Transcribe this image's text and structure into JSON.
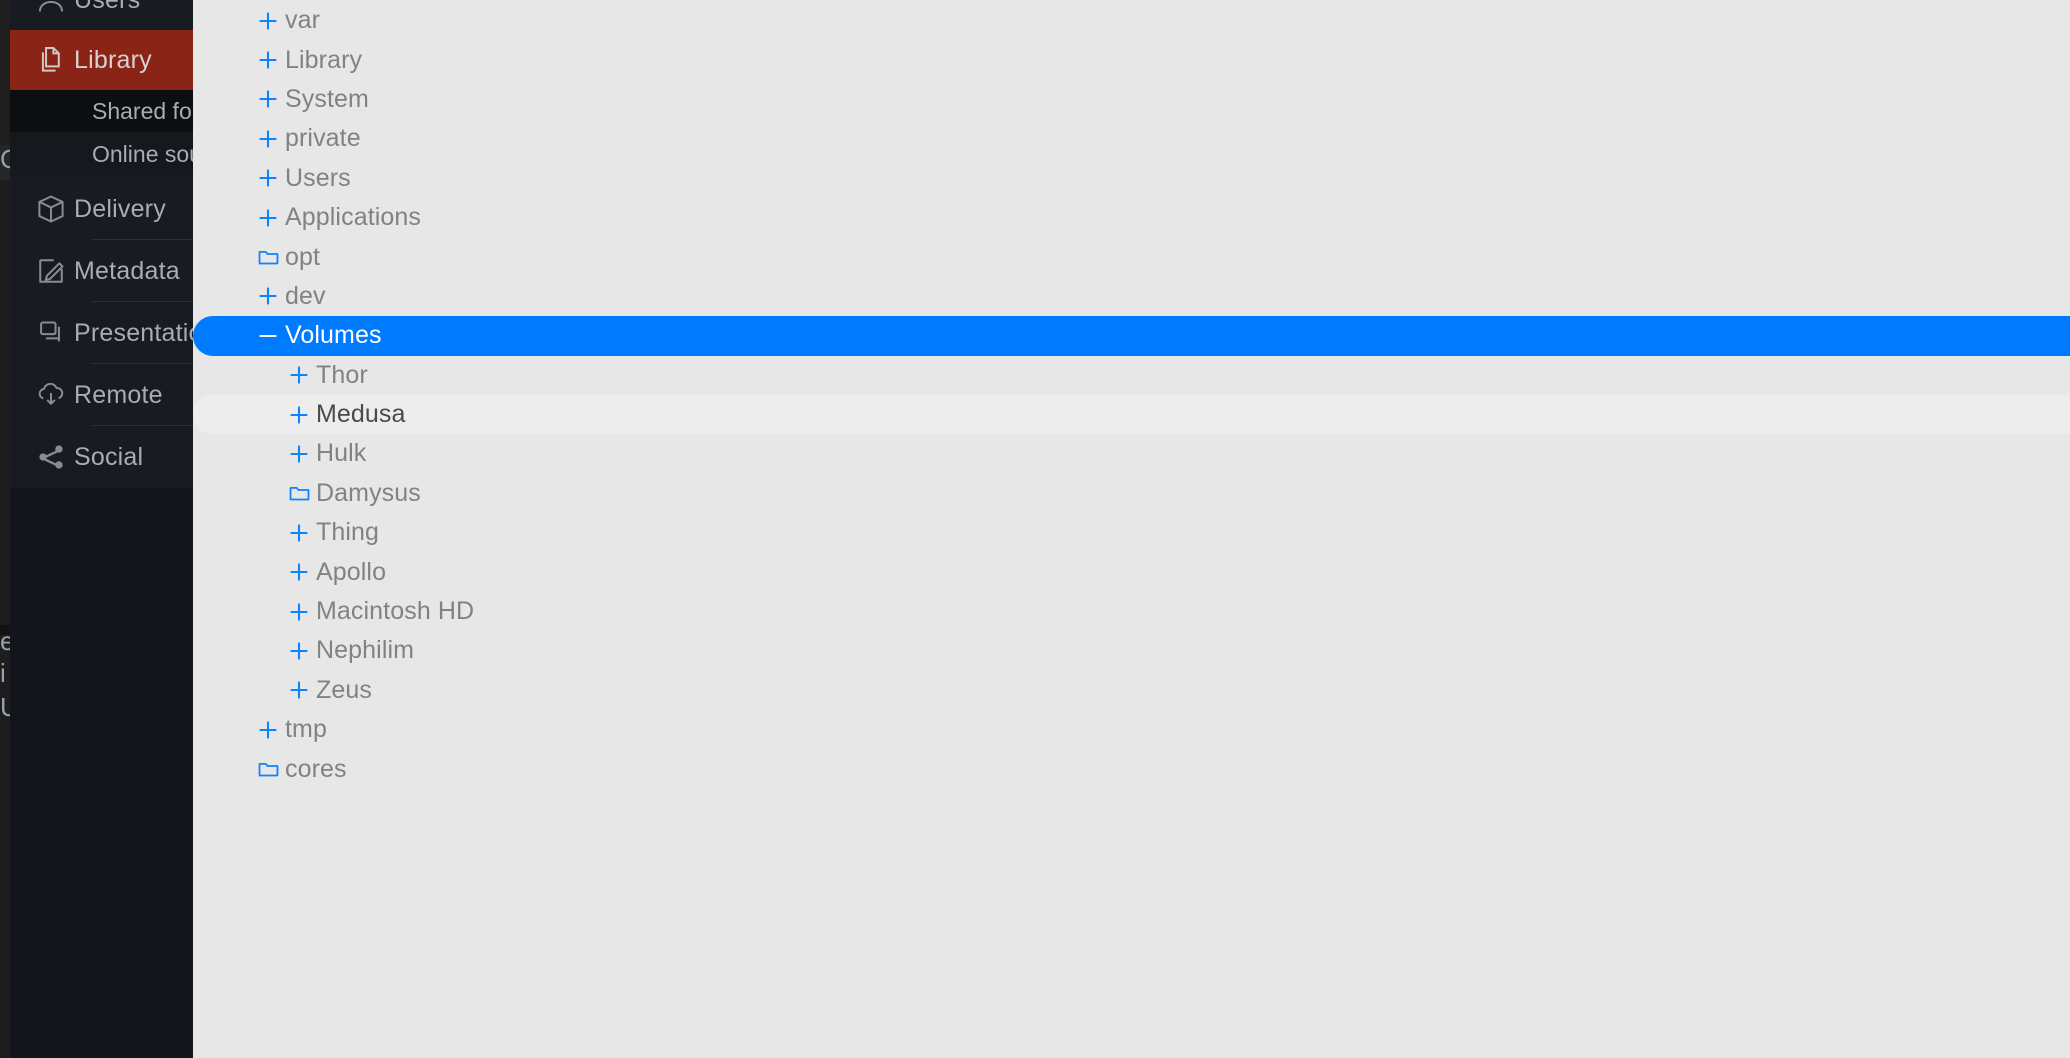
{
  "theme": {
    "sidebar_bg": "#181c20",
    "sidebar_active_bg": "#8a2417",
    "sidebar_sub_bg": "#0c0e10",
    "tree_bg": "#e7e7e7",
    "selection_blue": "#007aff",
    "expander_blue": "#0a84ff",
    "hover_bg": "#ededed",
    "tree_text": "#828282",
    "sidebar_text": "#a7adb3"
  },
  "sidebar": {
    "items": [
      {
        "label": "Users",
        "icon": "user-icon",
        "state": "normal",
        "type": "item"
      },
      {
        "label": "Library",
        "icon": "documents-icon",
        "state": "active",
        "type": "item"
      },
      {
        "label": "Shared folders",
        "icon": "",
        "state": "normal",
        "type": "sub"
      },
      {
        "label": "Online sources",
        "icon": "",
        "state": "normal",
        "type": "sub"
      },
      {
        "label": "Delivery",
        "icon": "box-icon",
        "state": "normal",
        "type": "item"
      },
      {
        "label": "Metadata",
        "icon": "pencil-edit-icon",
        "state": "normal",
        "type": "item"
      },
      {
        "label": "Presentation",
        "icon": "windows-icon",
        "state": "normal",
        "type": "item"
      },
      {
        "label": "Remote",
        "icon": "cloud-download-icon",
        "state": "normal",
        "type": "item"
      },
      {
        "label": "Social",
        "icon": "share-icon",
        "state": "normal",
        "type": "item"
      }
    ]
  },
  "edge_fragments": [
    {
      "text": "C"
    },
    {
      "text": "e"
    },
    {
      "text": "i"
    },
    {
      "text": "U"
    }
  ],
  "tree": {
    "nodes": [
      {
        "label": "var",
        "depth": 1,
        "expander": "plus",
        "state": "normal"
      },
      {
        "label": "Library",
        "depth": 1,
        "expander": "plus",
        "state": "normal"
      },
      {
        "label": "System",
        "depth": 1,
        "expander": "plus",
        "state": "normal"
      },
      {
        "label": "private",
        "depth": 1,
        "expander": "plus",
        "state": "normal"
      },
      {
        "label": "Users",
        "depth": 1,
        "expander": "plus",
        "state": "normal"
      },
      {
        "label": "Applications",
        "depth": 1,
        "expander": "plus",
        "state": "normal"
      },
      {
        "label": "opt",
        "depth": 1,
        "expander": "folder",
        "state": "normal"
      },
      {
        "label": "dev",
        "depth": 1,
        "expander": "plus",
        "state": "normal"
      },
      {
        "label": "Volumes",
        "depth": 1,
        "expander": "minus",
        "state": "selected"
      },
      {
        "label": "Thor",
        "depth": 2,
        "expander": "plus",
        "state": "normal"
      },
      {
        "label": "Medusa",
        "depth": 2,
        "expander": "plus",
        "state": "hovered"
      },
      {
        "label": "Hulk",
        "depth": 2,
        "expander": "plus",
        "state": "normal"
      },
      {
        "label": "Damysus",
        "depth": 2,
        "expander": "folder",
        "state": "normal"
      },
      {
        "label": "Thing",
        "depth": 2,
        "expander": "plus",
        "state": "normal"
      },
      {
        "label": "Apollo",
        "depth": 2,
        "expander": "plus",
        "state": "normal"
      },
      {
        "label": "Macintosh HD",
        "depth": 2,
        "expander": "plus",
        "state": "normal"
      },
      {
        "label": "Nephilim",
        "depth": 2,
        "expander": "plus",
        "state": "normal"
      },
      {
        "label": "Zeus",
        "depth": 2,
        "expander": "plus",
        "state": "normal"
      },
      {
        "label": "tmp",
        "depth": 1,
        "expander": "plus",
        "state": "normal"
      },
      {
        "label": "cores",
        "depth": 1,
        "expander": "folder",
        "state": "normal"
      }
    ]
  }
}
